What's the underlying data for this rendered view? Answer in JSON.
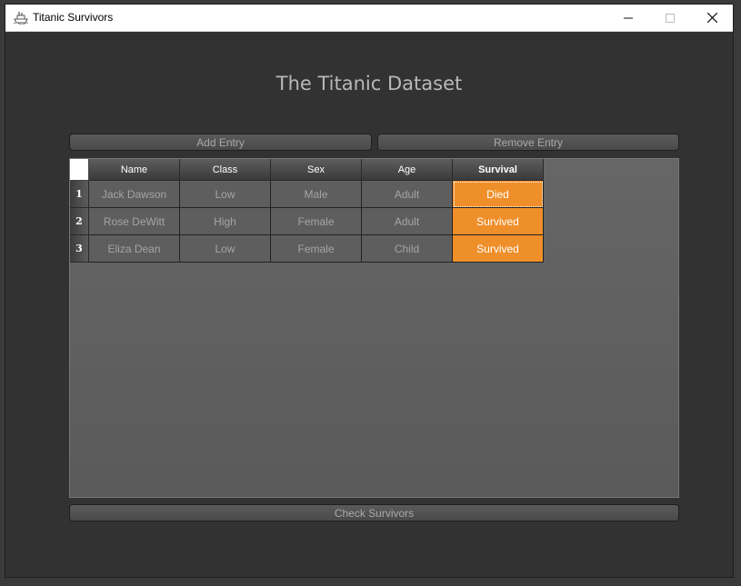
{
  "window": {
    "title": "Titanic Survivors",
    "icon": "ship-icon"
  },
  "heading": "The Titanic Dataset",
  "toolbar": {
    "add_label": "Add Entry",
    "remove_label": "Remove Entry"
  },
  "table": {
    "columns": [
      "Name",
      "Class",
      "Sex",
      "Age",
      "Survival"
    ],
    "rows": [
      {
        "num": "1",
        "cells": [
          "Jack Dawson",
          "Low",
          "Male",
          "Adult",
          "Died"
        ]
      },
      {
        "num": "2",
        "cells": [
          "Rose DeWitt",
          "High",
          "Female",
          "Adult",
          "Survived"
        ]
      },
      {
        "num": "3",
        "cells": [
          "Eliza Dean",
          "Low",
          "Female",
          "Child",
          "Survived"
        ]
      }
    ]
  },
  "footer": {
    "check_label": "Check Survivors"
  },
  "colors": {
    "accent": "#ef8f2a",
    "background": "#323232",
    "table_bg": "#5e5e5e"
  }
}
